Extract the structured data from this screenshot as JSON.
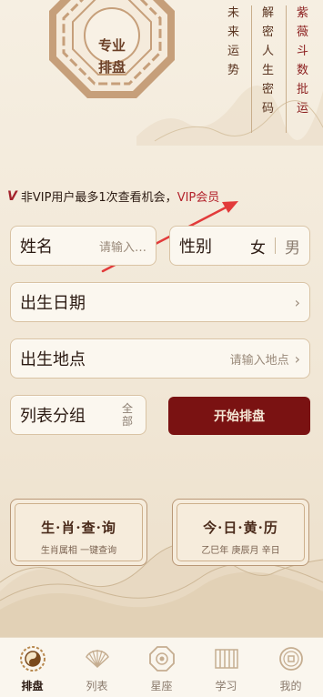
{
  "header": {
    "bagua_text_line1": "专业",
    "bagua_text_line2": "排盘",
    "poem_cols": [
      {
        "chars": [
          "未",
          "来",
          "运",
          "势"
        ],
        "red": false
      },
      {
        "chars": [
          "解",
          "密",
          "人",
          "生",
          "密",
          "码"
        ],
        "red": false
      },
      {
        "chars": [
          "紫",
          "薇",
          "斗",
          "数",
          "批",
          "运"
        ],
        "red": true
      }
    ]
  },
  "notice": {
    "prefix": "非VIP用户最多1次查看机会，",
    "link": "VIP会员"
  },
  "form": {
    "name_label": "姓名",
    "name_placeholder": "请输入…",
    "gender_label": "性别",
    "gender_female": "女",
    "gender_male": "男",
    "date_label": "出生日期",
    "place_label": "出生地点",
    "place_placeholder": "请输入地点",
    "group_label": "列表分组",
    "group_value": "全部",
    "start_button": "开始排盘"
  },
  "cards": {
    "zodiac_title": "生·肖·查·询",
    "zodiac_sub": "生肖属相 一键查询",
    "today_title": "今·日·黄·历",
    "today_sub": "乙巳年 庚辰月 辛日"
  },
  "nav": {
    "items": [
      {
        "label": "排盘",
        "icon": "taiji-icon",
        "active": true
      },
      {
        "label": "列表",
        "icon": "fan-icon",
        "active": false
      },
      {
        "label": "星座",
        "icon": "octagon-icon",
        "active": false
      },
      {
        "label": "学习",
        "icon": "book-icon",
        "active": false
      },
      {
        "label": "我的",
        "icon": "coin-icon",
        "active": false
      }
    ]
  },
  "colors": {
    "accent": "#7a1212",
    "annotation": "#e23b3b"
  }
}
